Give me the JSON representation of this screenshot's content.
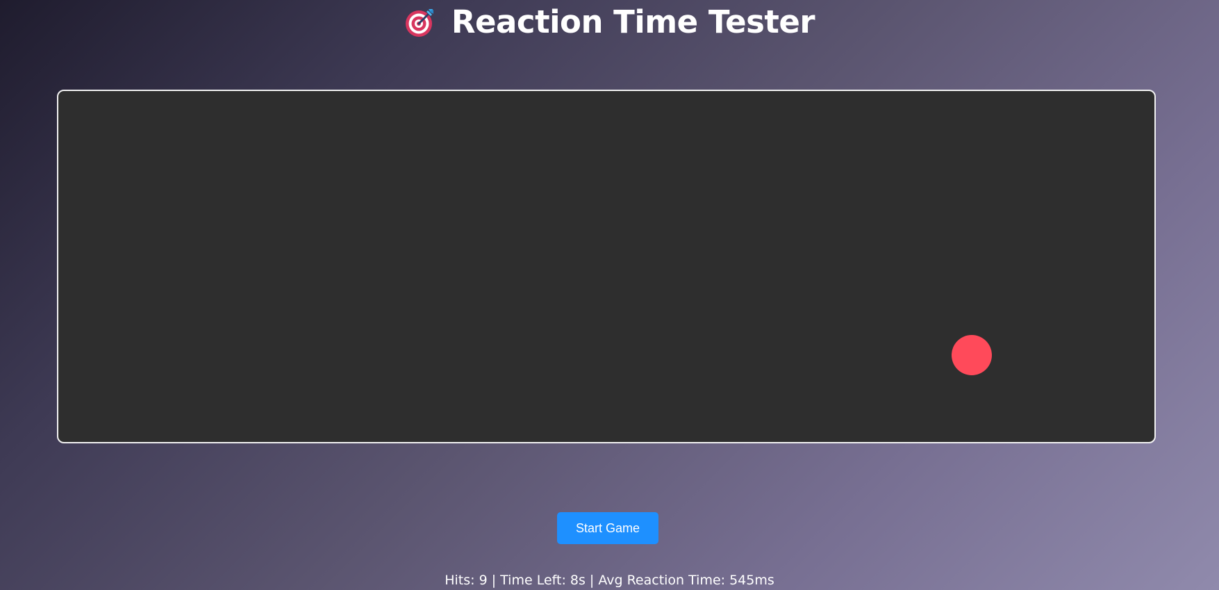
{
  "header": {
    "icon": "target-dart-icon",
    "title": "Reaction Time Tester"
  },
  "game": {
    "arena_color": "#2e2e2e",
    "target_color": "#ff4a5a",
    "target_icon": "target-circle"
  },
  "controls": {
    "start_label": "Start Game",
    "accent_color": "#1e90ff"
  },
  "stats": {
    "line": "Hits: 9 | Time Left: 8s | Avg Reaction Time: 545ms"
  }
}
